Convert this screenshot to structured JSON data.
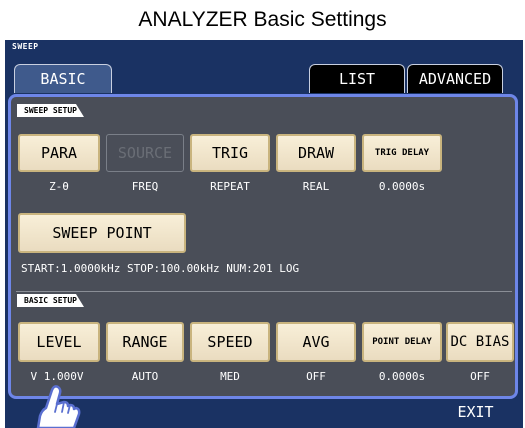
{
  "header": {
    "title": "ANALYZER Basic Settings"
  },
  "screen_label": "SWEEP",
  "tabs": {
    "basic": "BASIC",
    "list": "LIST",
    "advanced": "ADVANCED"
  },
  "sweep_setup": {
    "label": "SWEEP SETUP",
    "para": {
      "label": "PARA",
      "value": "Z-θ"
    },
    "source": {
      "label": "SOURCE",
      "value": "FREQ"
    },
    "trig": {
      "label": "TRIG",
      "value": "REPEAT"
    },
    "draw": {
      "label": "DRAW",
      "value": "REAL"
    },
    "trig_delay": {
      "label": "TRIG DELAY",
      "value": "0.0000s"
    },
    "sweep_point": {
      "label": "SWEEP POINT"
    },
    "info": "START:1.0000kHz STOP:100.00kHz NUM:201 LOG"
  },
  "basic_setup": {
    "label": "BASIC SETUP",
    "level": {
      "label": "LEVEL",
      "value": "V 1.000V"
    },
    "range": {
      "label": "RANGE",
      "value": "AUTO"
    },
    "speed": {
      "label": "SPEED",
      "value": "MED"
    },
    "avg": {
      "label": "AVG",
      "value": "OFF"
    },
    "point_delay": {
      "label": "POINT DELAY",
      "value": "0.0000s"
    },
    "dc_bias": {
      "label": "DC BIAS",
      "value": "OFF"
    }
  },
  "exit_label": "EXIT",
  "colors": {
    "screen_bg": "#1a3263",
    "panel_bg": "#4a4e58",
    "panel_border": "#6e86e8",
    "button_bg": "#f5ecd6"
  },
  "icons": {
    "pointer": "hand-pointer-icon"
  }
}
